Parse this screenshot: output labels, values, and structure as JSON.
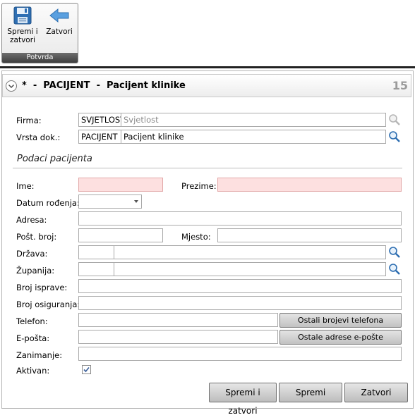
{
  "ribbon": {
    "save_close_label": "Spremi i zatvori",
    "close_label": "Zatvori",
    "group_label": "Potvrda"
  },
  "header": {
    "title": "*  -  PACIJENT  -  Pacijent klinike",
    "number": "15"
  },
  "form": {
    "firma_label": "Firma:",
    "firma_code": "SVJETLOST",
    "firma_name": "Svjetlost",
    "vrsta_label": "Vrsta dok.:",
    "vrsta_code": "PACIJENT",
    "vrsta_name": "Pacijent klinike",
    "section_title": "Podaci pacijenta",
    "ime_label": "Ime:",
    "ime_value": "",
    "prezime_label": "Prezime:",
    "prezime_value": "",
    "datum_label": "Datum rođenja:",
    "datum_value": "",
    "adresa_label": "Adresa:",
    "adresa_value": "",
    "post_label": "Pošt. broj:",
    "post_value": "",
    "mjesto_label": "Mjesto:",
    "mjesto_value": "",
    "drzava_label": "Država:",
    "drzava_code": "",
    "drzava_name": "",
    "zupanija_label": "Županija:",
    "zupanija_code": "",
    "zupanija_name": "",
    "isprava_label": "Broj isprave:",
    "isprava_value": "",
    "osiguranje_label": "Broj osiguranja:",
    "osiguranje_value": "",
    "telefon_label": "Telefon:",
    "telefon_value": "",
    "telefon_more": "Ostali brojevi telefona",
    "email_label": "E-pošta:",
    "email_value": "",
    "email_more": "Ostale adrese e-pošte",
    "zanimanje_label": "Zanimanje:",
    "zanimanje_value": "",
    "aktivan_label": "Aktivan:",
    "aktivan_checked": true
  },
  "buttons": {
    "save_close": "Spremi i zatvori",
    "save": "Spremi",
    "close": "Zatvori"
  },
  "colors": {
    "required_field": "#fde0e0",
    "ribbon_group_label_bg": "#4a4a4a",
    "header_number": "#9b9b9b"
  },
  "icons": {
    "save": "floppy-disk-icon",
    "close": "back-arrow-icon",
    "lookup": "magnifier-icon",
    "expand": "chevron-down-icon",
    "dropdown": "caret-down-icon",
    "check": "checkmark-icon"
  }
}
